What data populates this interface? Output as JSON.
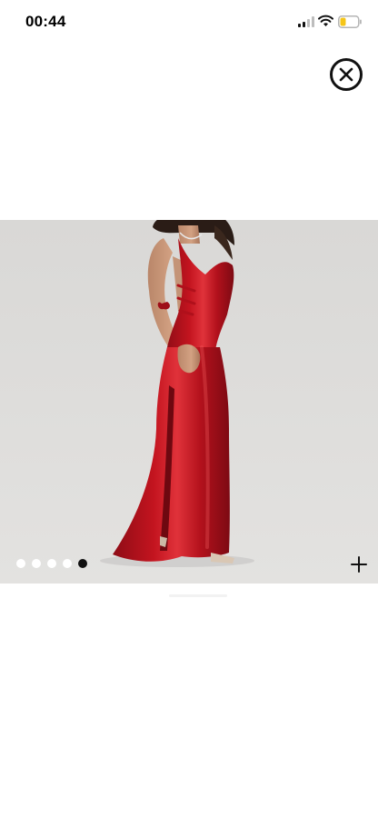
{
  "status_bar": {
    "time": "00:44",
    "icons": [
      "signal-icon",
      "wifi-icon",
      "battery-icon"
    ],
    "battery_color": "#f5c518"
  },
  "viewer": {
    "close_icon": "close-icon",
    "add_icon": "plus-icon",
    "image": {
      "subject": "red-satin-halter-gown",
      "dress_color": "#c01420",
      "background_color": "#dcdbd9"
    },
    "pagination": {
      "total": 5,
      "active_index": 5,
      "active_color": "#111111",
      "inactive_color": "#ffffff"
    }
  }
}
